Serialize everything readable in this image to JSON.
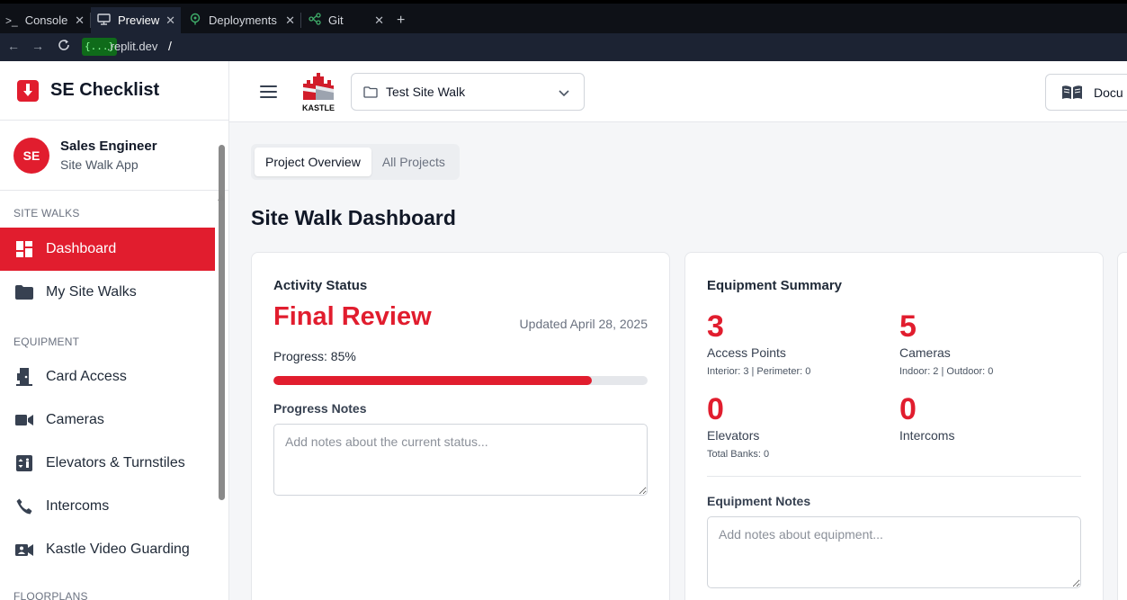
{
  "browser": {
    "tabs": [
      {
        "label": "Console",
        "icon": "terminal-icon"
      },
      {
        "label": "Preview",
        "icon": "monitor-icon"
      },
      {
        "label": "Deployments",
        "icon": "deploy-icon"
      },
      {
        "label": "Git",
        "icon": "git-icon"
      }
    ],
    "url_pill": "{...}",
    "url_domain": ".replit.dev",
    "url_path": "/"
  },
  "sidebar": {
    "brand": "SE Checklist",
    "user": {
      "initials": "SE",
      "name": "Sales Engineer",
      "role": "Site Walk App"
    },
    "sections": [
      {
        "title": "SITE WALKS",
        "items": [
          {
            "label": "Dashboard",
            "icon": "dashboard-icon",
            "active": true
          },
          {
            "label": "My Site Walks",
            "icon": "folder-icon"
          }
        ]
      },
      {
        "title": "EQUIPMENT",
        "items": [
          {
            "label": "Card Access",
            "icon": "door-icon"
          },
          {
            "label": "Cameras",
            "icon": "camera-icon"
          },
          {
            "label": "Elevators & Turnstiles",
            "icon": "elevator-icon"
          },
          {
            "label": "Intercoms",
            "icon": "phone-icon"
          },
          {
            "label": "Kastle Video Guarding",
            "icon": "video-guard-icon"
          }
        ]
      },
      {
        "title": "FLOORPLANS"
      }
    ]
  },
  "header": {
    "logo_text": "KASTLE",
    "site_select": "Test Site Walk",
    "docs_label": "Docu"
  },
  "tabs": [
    {
      "label": "Project Overview",
      "active": true
    },
    {
      "label": "All Projects"
    }
  ],
  "page_title": "Site Walk Dashboard",
  "activity": {
    "title": "Activity Status",
    "status": "Final Review",
    "updated": "Updated April 28, 2025",
    "progress_label": "Progress: 85%",
    "progress_value": 0.85,
    "notes_label": "Progress Notes",
    "notes_placeholder": "Add notes about the current status..."
  },
  "equipment": {
    "title": "Equipment Summary",
    "items": [
      {
        "count": "3",
        "label": "Access Points",
        "sub": "Interior: 3 | Perimeter: 0"
      },
      {
        "count": "5",
        "label": "Cameras",
        "sub": "Indoor: 2 | Outdoor: 0"
      },
      {
        "count": "0",
        "label": "Elevators",
        "sub": "Total Banks: 0"
      },
      {
        "count": "0",
        "label": "Intercoms",
        "sub": ""
      }
    ],
    "notes_label": "Equipment Notes",
    "notes_placeholder": "Add notes about equipment..."
  },
  "colors": {
    "accent": "#e11d2e",
    "chrome_bg": "#0e1117"
  }
}
